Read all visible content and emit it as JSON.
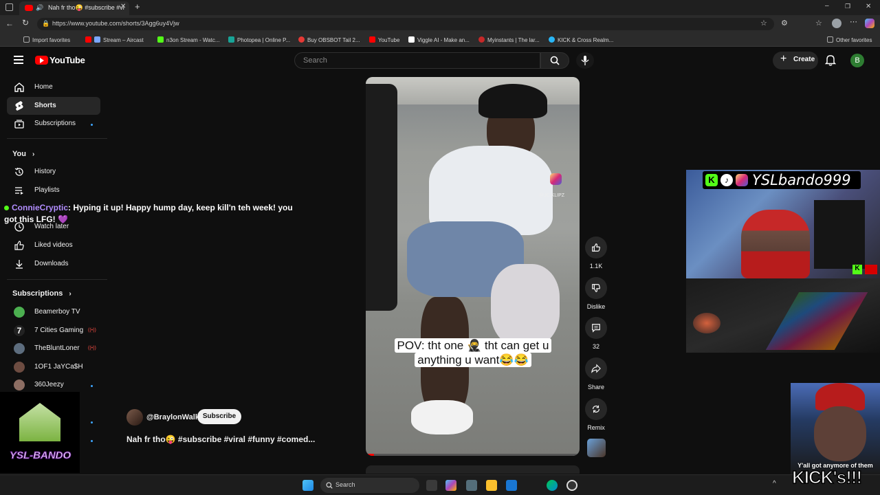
{
  "browser": {
    "tab_title": "Nah fr tho😜 #subscribe #vi",
    "url": "https://www.youtube.com/shorts/3Agg6uy4Vjw",
    "bookmarks": [
      "Import favorites",
      "Stream – Aircast",
      "n3on Stream - Watc...",
      "Photopea | Online P...",
      "Buy OBSBOT Tail 2...",
      "YouTube",
      "Viggle AI - Make an...",
      "Myinstants | The lar...",
      "KICK & Cross Realm...",
      "Other favorites"
    ]
  },
  "header": {
    "logo": "YouTube",
    "search_placeholder": "Search",
    "create_label": "Create",
    "avatar_letter": "B"
  },
  "sidebar": {
    "main": [
      {
        "label": "Home",
        "icon": "home-icon"
      },
      {
        "label": "Shorts",
        "icon": "shorts-icon"
      },
      {
        "label": "Subscriptions",
        "icon": "subscriptions-icon"
      }
    ],
    "you_title": "You",
    "you_items": [
      {
        "label": "History",
        "icon": "history-icon"
      },
      {
        "label": "Playlists",
        "icon": "playlists-icon"
      },
      {
        "label": "Watch later",
        "icon": "clock-icon"
      },
      {
        "label": "Liked videos",
        "icon": "thumbs-up-icon"
      },
      {
        "label": "Downloads",
        "icon": "download-icon"
      }
    ],
    "subs_title": "Subscriptions",
    "subs_items": [
      "Beamerboy TV",
      "7 Cities Gaming",
      "TheBluntLoner",
      "1OF1 JaYCa$H",
      "360Jeezy"
    ]
  },
  "chat_overlay": {
    "username": "ConnieCryptic",
    "message": ": Hyping it up! Happy hump day, keep kill'n teh week! you got this LFG! 💜"
  },
  "short": {
    "caption": "POV: tht one 🥷 tht can get u anything u want😂😂",
    "watermark": "@JC.KLIPZ",
    "channel": "@BraylonWalk",
    "subscribe_label": "Subscribe",
    "title": "Nah fr tho😜 #subscribe #viral #funny #comed...",
    "likes": "1.1K",
    "dislike_label": "Dislike",
    "comments": "32",
    "share_label": "Share",
    "remix_label": "Remix"
  },
  "stream_overlay": {
    "streamer_name": "YSLbando999",
    "logo_text": "YSL-BANDO",
    "meme_caption_1": "Y'all got anymore of them",
    "meme_caption_2": "KICK's!!!"
  },
  "taskbar": {
    "search_placeholder": "Search"
  },
  "colors": {
    "youtube_red": "#ff0000",
    "background": "#0f0f0f",
    "kick_green": "#53fc18"
  }
}
